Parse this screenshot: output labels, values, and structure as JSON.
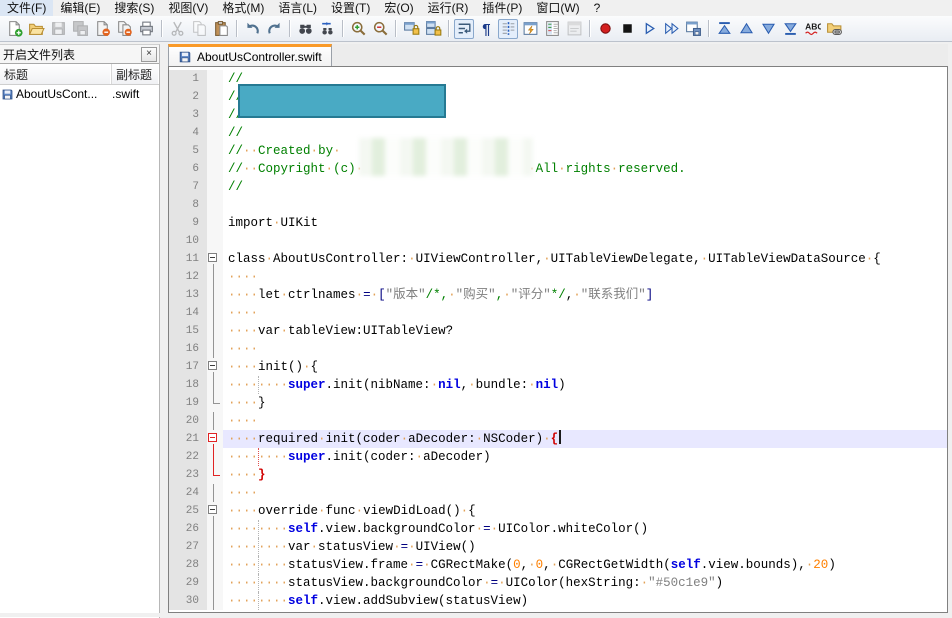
{
  "menu": {
    "items": [
      "文件(F)",
      "编辑(E)",
      "搜索(S)",
      "视图(V)",
      "格式(M)",
      "语言(L)",
      "设置(T)",
      "宏(O)",
      "运行(R)",
      "插件(P)",
      "窗口(W)",
      "?"
    ]
  },
  "toolbar": {
    "items": [
      {
        "n": "new-file"
      },
      {
        "n": "open-file"
      },
      {
        "n": "save",
        "d": true
      },
      {
        "n": "save-all",
        "d": true
      },
      {
        "n": "close-file"
      },
      {
        "n": "close-all"
      },
      {
        "n": "print"
      },
      {
        "n": "sep"
      },
      {
        "n": "cut",
        "d": true
      },
      {
        "n": "copy",
        "d": true
      },
      {
        "n": "paste"
      },
      {
        "n": "sep"
      },
      {
        "n": "undo"
      },
      {
        "n": "redo"
      },
      {
        "n": "sep"
      },
      {
        "n": "find"
      },
      {
        "n": "replace"
      },
      {
        "n": "sep"
      },
      {
        "n": "zoom-in"
      },
      {
        "n": "zoom-out"
      },
      {
        "n": "sep"
      },
      {
        "n": "sync-vertical"
      },
      {
        "n": "sync-horizontal"
      },
      {
        "n": "sep"
      },
      {
        "n": "word-wrap",
        "p": true
      },
      {
        "n": "show-all-characters"
      },
      {
        "n": "indent-guide",
        "p": true
      },
      {
        "n": "function-completion"
      },
      {
        "n": "document-map"
      },
      {
        "n": "document-switcher",
        "d": true
      },
      {
        "n": "sep"
      },
      {
        "n": "macro-record"
      },
      {
        "n": "macro-stop"
      },
      {
        "n": "macro-play"
      },
      {
        "n": "macro-run-multiple"
      },
      {
        "n": "macro-save"
      },
      {
        "n": "sep"
      },
      {
        "n": "nav-first"
      },
      {
        "n": "nav-previous"
      },
      {
        "n": "nav-next"
      },
      {
        "n": "nav-last"
      },
      {
        "n": "spell-check"
      },
      {
        "n": "folder-as-workspace"
      }
    ]
  },
  "panel": {
    "title": "开启文件列表",
    "close_label": "×",
    "columns": [
      "标题",
      "副标题"
    ],
    "rows": [
      {
        "title": "AboutUsCont...",
        "subtitle": ".swift"
      }
    ]
  },
  "editor": {
    "tab": {
      "label": "AboutUsController.swift"
    },
    "language_colors": {
      "comment": "#008000",
      "keyword": "#0000e0",
      "number": "#ff8000",
      "string": "#808080",
      "operator": "#000080",
      "brace_match": "#d00000",
      "current_line_bg": "#e8e8ff",
      "tab_accent": "#fa9a28",
      "redaction_teal": "#49aac4",
      "status_hex_in_code": "#50c1e9"
    },
    "lines": [
      {
        "n": 1,
        "seg": [
          [
            "c",
            "//"
          ]
        ]
      },
      {
        "n": 2,
        "seg": [
          [
            "c",
            "//"
          ]
        ]
      },
      {
        "n": 3,
        "seg": [
          [
            "c",
            "//"
          ]
        ]
      },
      {
        "n": 4,
        "seg": [
          [
            "c",
            "//"
          ]
        ]
      },
      {
        "n": 5,
        "seg": [
          [
            "c",
            "//  Created by "
          ]
        ]
      },
      {
        "n": 6,
        "seg": [
          [
            "c",
            "//  Copyright (c)                        All rights reserved."
          ]
        ]
      },
      {
        "n": 7,
        "seg": [
          [
            "c",
            "//"
          ]
        ]
      },
      {
        "n": 8,
        "seg": []
      },
      {
        "n": 9,
        "seg": [
          [
            "d",
            "import UIKit"
          ]
        ]
      },
      {
        "n": 10,
        "seg": []
      },
      {
        "n": 11,
        "f": "box",
        "seg": [
          [
            "d",
            "class AboutUsController: UIViewController, UITableViewDelegate, UITableViewDataSource {"
          ]
        ]
      },
      {
        "n": 12,
        "f": "line",
        "seg": [
          [
            "d",
            "    "
          ]
        ]
      },
      {
        "n": 13,
        "f": "line",
        "seg": [
          [
            "d",
            "    let ctrlnames "
          ],
          [
            "o",
            "= ["
          ],
          [
            "s",
            "\"版本\""
          ],
          [
            "c",
            "/*, "
          ],
          [
            "s",
            "\"购买\""
          ],
          [
            "c",
            ", "
          ],
          [
            "s",
            "\"评分\""
          ],
          [
            "c",
            "*/"
          ],
          [
            "d",
            ", "
          ],
          [
            "s",
            "\"联系我们\""
          ],
          [
            "o",
            "]"
          ]
        ]
      },
      {
        "n": 14,
        "f": "line",
        "seg": [
          [
            "d",
            "    "
          ]
        ]
      },
      {
        "n": 15,
        "f": "line",
        "seg": [
          [
            "d",
            "    var tableView:UITableView?"
          ]
        ]
      },
      {
        "n": 16,
        "f": "line",
        "seg": [
          [
            "d",
            "    "
          ]
        ]
      },
      {
        "n": 17,
        "f": "box",
        "seg": [
          [
            "d",
            "    init() {"
          ]
        ]
      },
      {
        "n": 18,
        "f": "line",
        "g": "g",
        "seg": [
          [
            "d",
            "        "
          ],
          [
            "k",
            "super"
          ],
          [
            "d",
            ".init(nibName: "
          ],
          [
            "k",
            "nil"
          ],
          [
            "d",
            ", bundle: "
          ],
          [
            "k",
            "nil"
          ],
          [
            "d",
            ")"
          ]
        ]
      },
      {
        "n": 19,
        "f": "end",
        "seg": [
          [
            "d",
            "    }"
          ]
        ]
      },
      {
        "n": 20,
        "f": "line",
        "seg": [
          [
            "d",
            "    "
          ]
        ]
      },
      {
        "n": 21,
        "f": "box-red",
        "cur": true,
        "seg": [
          [
            "d",
            "    required init(coder aDecoder: NSCoder) "
          ],
          [
            "b",
            "{"
          ],
          [
            "caret",
            ""
          ]
        ]
      },
      {
        "n": 22,
        "f": "line-red",
        "g": "r",
        "seg": [
          [
            "d",
            "        "
          ],
          [
            "k",
            "super"
          ],
          [
            "d",
            ".init(coder: aDecoder)"
          ]
        ]
      },
      {
        "n": 23,
        "f": "end-red",
        "seg": [
          [
            "d",
            "    "
          ],
          [
            "b",
            "}"
          ]
        ]
      },
      {
        "n": 24,
        "f": "line",
        "seg": [
          [
            "d",
            "    "
          ]
        ]
      },
      {
        "n": 25,
        "f": "box",
        "seg": [
          [
            "d",
            "    override func viewDidLoad() {"
          ]
        ]
      },
      {
        "n": 26,
        "f": "line",
        "g": "g",
        "seg": [
          [
            "d",
            "        "
          ],
          [
            "k",
            "self"
          ],
          [
            "d",
            ".view.backgroundColor "
          ],
          [
            "o",
            "="
          ],
          [
            "d",
            " UIColor.whiteColor()"
          ]
        ]
      },
      {
        "n": 27,
        "f": "line",
        "g": "g",
        "seg": [
          [
            "d",
            "        var statusView "
          ],
          [
            "o",
            "="
          ],
          [
            "d",
            " UIView()"
          ]
        ]
      },
      {
        "n": 28,
        "f": "line",
        "g": "g",
        "seg": [
          [
            "d",
            "        statusView.frame "
          ],
          [
            "o",
            "="
          ],
          [
            "d",
            " CGRectMake("
          ],
          [
            "num",
            "0"
          ],
          [
            "d",
            ", "
          ],
          [
            "num",
            "0"
          ],
          [
            "d",
            ", CGRectGetWidth("
          ],
          [
            "k",
            "self"
          ],
          [
            "d",
            ".view.bounds), "
          ],
          [
            "num",
            "20"
          ],
          [
            "d",
            ")"
          ]
        ]
      },
      {
        "n": 29,
        "f": "line",
        "g": "g",
        "seg": [
          [
            "d",
            "        statusView.backgroundColor "
          ],
          [
            "o",
            "="
          ],
          [
            "d",
            " UIColor(hexString: "
          ],
          [
            "s",
            "\"#50c1e9\""
          ],
          [
            "d",
            ")"
          ]
        ]
      },
      {
        "n": 30,
        "f": "line",
        "g": "g",
        "seg": [
          [
            "d",
            "        "
          ],
          [
            "k",
            "self"
          ],
          [
            "d",
            ".view.addSubview(statusView)"
          ]
        ]
      }
    ]
  }
}
